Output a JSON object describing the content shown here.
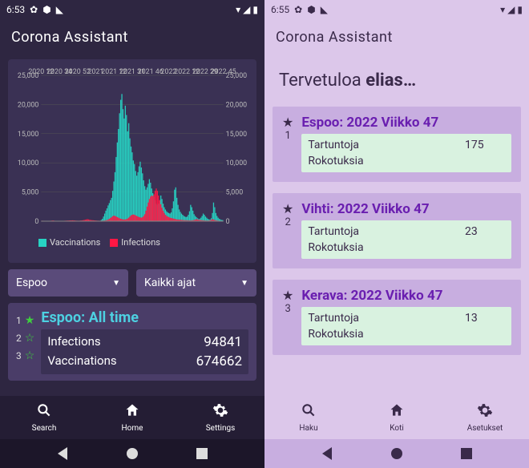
{
  "left": {
    "status_time": "6:53",
    "app_title": "Corona  Assistant",
    "dropdown_region": "Espoo",
    "dropdown_time": "Kaikki ajat",
    "legend_vacc": "Vaccinations",
    "legend_inf": "Infections",
    "summary": {
      "ranks": [
        "1",
        "2",
        "3"
      ],
      "stars": [
        "filled",
        "outline",
        "outline"
      ],
      "title": "Espoo: All time",
      "rows": [
        {
          "label": "Infections",
          "value": "94841"
        },
        {
          "label": "Vaccinations",
          "value": "674662"
        }
      ]
    },
    "nav": [
      {
        "icon": "search",
        "label": "Search"
      },
      {
        "icon": "home",
        "label": "Home"
      },
      {
        "icon": "settings",
        "label": "Settings"
      }
    ]
  },
  "right": {
    "status_time": "6:55",
    "app_title": "Corona  Assistant",
    "welcome_pre": "Tervetuloa ",
    "welcome_name": "elias…",
    "cards": [
      {
        "rank": "1",
        "title": "Espoo: 2022 Viikko 47",
        "rows": [
          {
            "label": "Tartuntoja",
            "value": "175"
          },
          {
            "label": "Rokotuksia",
            "value": ""
          }
        ]
      },
      {
        "rank": "2",
        "title": "Vihti: 2022 Viikko 47",
        "rows": [
          {
            "label": "Tartuntoja",
            "value": "23"
          },
          {
            "label": "Rokotuksia",
            "value": ""
          }
        ]
      },
      {
        "rank": "3",
        "title": "Kerava: 2022 Viikko 47",
        "rows": [
          {
            "label": "Tartuntoja",
            "value": "13"
          },
          {
            "label": "Rokotuksia",
            "value": ""
          }
        ]
      }
    ],
    "nav": [
      {
        "icon": "search",
        "label": "Haku"
      },
      {
        "icon": "home",
        "label": "Koti"
      },
      {
        "icon": "settings",
        "label": "Asetukset"
      }
    ]
  },
  "chart_data": {
    "type": "bar",
    "title": "",
    "x_ticks": [
      "2020 12",
      "2020 34",
      "2020 52",
      "2021",
      "2021 12",
      "2021 31",
      "2021 46",
      "2022",
      "2022 12",
      "2022 29",
      "2022 45"
    ],
    "ylim": [
      0,
      25000
    ],
    "y_step": 5000,
    "series": [
      {
        "name": "Vaccinations",
        "color": "#27d3c3",
        "values": [
          0,
          0,
          0,
          0,
          0,
          0,
          0,
          0,
          0,
          0,
          0,
          0,
          0,
          0,
          0,
          0,
          0,
          0,
          0,
          0,
          0,
          0,
          0,
          0,
          0,
          0,
          0,
          0,
          0,
          0,
          0,
          0,
          0,
          0,
          0,
          0,
          0,
          0,
          0,
          0,
          0,
          0,
          0,
          0,
          0,
          0,
          0,
          0,
          0,
          0,
          0,
          0,
          200,
          400,
          800,
          1300,
          1800,
          2200,
          2700,
          3100,
          3600,
          4000,
          5200,
          6800,
          8400,
          11000,
          13500,
          15800,
          18500,
          20800,
          21800,
          19200,
          17600,
          19800,
          18200,
          15400,
          16800,
          14200,
          12800,
          11800,
          10400,
          9800,
          8600,
          7800,
          8400,
          9400,
          10200,
          9200,
          8200,
          7000,
          6000,
          5400,
          5800,
          6400,
          7200,
          6600,
          5600,
          4800,
          4200,
          3600,
          3000,
          2800,
          3000,
          3600,
          4400,
          3800,
          3000,
          2400,
          2000,
          1700,
          1500,
          1400,
          1300,
          1500,
          2200,
          3400,
          5400,
          5800,
          4000,
          2800,
          2000,
          1600,
          1300,
          1100,
          900,
          800,
          700,
          800,
          1100,
          1700,
          2800,
          2400,
          1800,
          1200,
          900,
          700,
          500,
          400,
          400,
          600,
          900,
          1300,
          1100,
          800,
          600,
          400,
          300,
          300,
          500,
          1400,
          3200,
          2400,
          1400,
          900,
          600,
          400,
          300,
          200,
          200
        ]
      },
      {
        "name": "Infections",
        "color": "#ff1744",
        "values": [
          50,
          80,
          60,
          40,
          30,
          20,
          40,
          60,
          80,
          100,
          120,
          90,
          70,
          50,
          40,
          30,
          40,
          50,
          60,
          70,
          80,
          90,
          100,
          110,
          120,
          130,
          140,
          150,
          140,
          120,
          100,
          90,
          80,
          90,
          110,
          130,
          160,
          200,
          250,
          300,
          350,
          300,
          250,
          200,
          180,
          160,
          140,
          120,
          100,
          90,
          80,
          70,
          80,
          90,
          100,
          120,
          150,
          200,
          280,
          400,
          550,
          700,
          850,
          950,
          900,
          800,
          700,
          600,
          500,
          420,
          350,
          300,
          280,
          300,
          350,
          450,
          600,
          800,
          1000,
          1100,
          1150,
          1100,
          1000,
          900,
          800,
          700,
          650,
          600,
          700,
          900,
          1200,
          1800,
          2500,
          3200,
          3800,
          4200,
          4400,
          4300,
          4600,
          5200,
          5600,
          5200,
          4400,
          3600,
          2900,
          2300,
          1800,
          1400,
          1100,
          900,
          800,
          700,
          600,
          550,
          500,
          450,
          400,
          350,
          300,
          280,
          260,
          240,
          220,
          200,
          180,
          170,
          160,
          150,
          140,
          130,
          130,
          140,
          160,
          200,
          260,
          340,
          300,
          260,
          220,
          190,
          160,
          140,
          120,
          110,
          100,
          100,
          120,
          160,
          240,
          360,
          280,
          200,
          150,
          120,
          100,
          80,
          70,
          60,
          50
        ]
      }
    ]
  }
}
